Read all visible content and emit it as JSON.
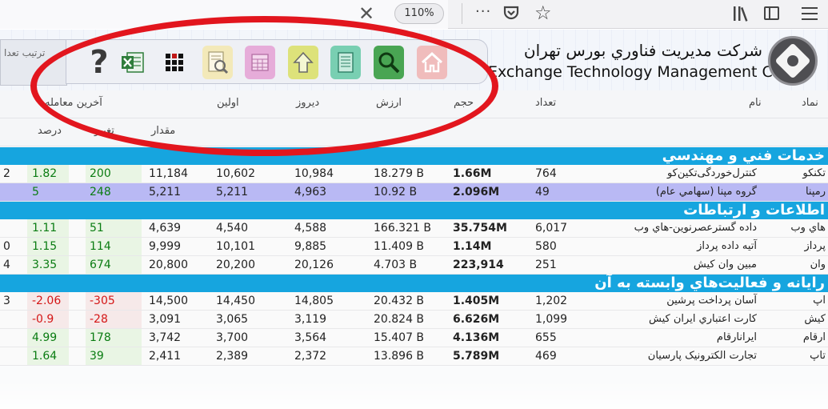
{
  "browser": {
    "close_glyph": "✕",
    "zoom": "110%",
    "more_glyph": "···",
    "star_glyph": "☆"
  },
  "header": {
    "left_field_text": "ترتیب تعدا",
    "left_field_text2": "ر",
    "company_fa": "شركت مديريت فناوري بورس تهران",
    "company_en": "Exchange Technology Management Co",
    "help_glyph": "?"
  },
  "table": {
    "header_top": {
      "last_trade": "آخرین معامله",
      "first": "اولین",
      "yesterday": "دیروز",
      "value": "ارزش",
      "volume": "حجم",
      "count": "تعداد",
      "name": "نام",
      "symbol": "نماد"
    },
    "header_sub": {
      "percent": "درصد",
      "change": "تغییر",
      "amount": "مقدار"
    },
    "sections": [
      {
        "title": "خدمات فني و مهندسي",
        "rows": [
          {
            "edge": "2",
            "pct": "1.82",
            "chg": "200",
            "last": "11,184",
            "first": "10,602",
            "yest": "10,984",
            "val": "18.279 B",
            "vol": "1.66M",
            "cnt": "764",
            "name": "کنترل‌خوردگی‌تکین‌کو",
            "sym": "تکنکو",
            "dir": "pos",
            "hl": false
          },
          {
            "edge": "",
            "pct": "5",
            "chg": "248",
            "last": "5,211",
            "first": "5,211",
            "yest": "4,963",
            "val": "10.92 B",
            "vol": "2.096M",
            "cnt": "49",
            "name": "گروه مپنا (سهامي عام)",
            "sym": "رمپنا",
            "dir": "pos",
            "hl": true
          }
        ]
      },
      {
        "title": "اطلاعات و ارتباطات",
        "rows": [
          {
            "edge": "",
            "pct": "1.11",
            "chg": "51",
            "last": "4,639",
            "first": "4,540",
            "yest": "4,588",
            "val": "166.321 B",
            "vol": "35.754M",
            "cnt": "6,017",
            "name": "داده گسترعصرنوين-هاي وب",
            "sym": "هاي وب",
            "dir": "pos",
            "hl": false
          },
          {
            "edge": "0",
            "pct": "1.15",
            "chg": "114",
            "last": "9,999",
            "first": "10,101",
            "yest": "9,885",
            "val": "11.409 B",
            "vol": "1.14M",
            "cnt": "580",
            "name": "آتیه داده پرداز",
            "sym": "پرداز",
            "dir": "pos",
            "hl": false
          },
          {
            "edge": "4",
            "pct": "3.35",
            "chg": "674",
            "last": "20,800",
            "first": "20,200",
            "yest": "20,126",
            "val": "4.703 B",
            "vol": "223,914",
            "cnt": "251",
            "name": "مبین وان کیش",
            "sym": "وان",
            "dir": "pos",
            "hl": false
          }
        ]
      },
      {
        "title": "رايانه و فعاليت‌هاي وابسته به آن",
        "rows": [
          {
            "edge": "3",
            "pct": "-2.06",
            "chg": "-305",
            "last": "14,500",
            "first": "14,450",
            "yest": "14,805",
            "val": "20.432 B",
            "vol": "1.405M",
            "cnt": "1,202",
            "name": "آسان پرداخت پرشین",
            "sym": "آپ",
            "dir": "neg",
            "hl": false
          },
          {
            "edge": "",
            "pct": "-0.9",
            "chg": "-28",
            "last": "3,091",
            "first": "3,065",
            "yest": "3,119",
            "val": "20.824 B",
            "vol": "6.626M",
            "cnt": "1,099",
            "name": "كارت اعتباري ايران كيش",
            "sym": "كيش",
            "dir": "neg",
            "hl": false
          },
          {
            "edge": "",
            "pct": "4.99",
            "chg": "178",
            "last": "3,742",
            "first": "3,700",
            "yest": "3,564",
            "val": "15.407 B",
            "vol": "4.136M",
            "cnt": "655",
            "name": "ايرانارقام",
            "sym": "ارقام",
            "dir": "pos",
            "hl": false
          },
          {
            "edge": "",
            "pct": "1.64",
            "chg": "39",
            "last": "2,411",
            "first": "2,389",
            "yest": "2,372",
            "val": "13.896 B",
            "vol": "5.789M",
            "cnt": "469",
            "name": "تجارت الکترونیک پارسیان",
            "sym": "تاپ",
            "dir": "pos",
            "hl": false
          }
        ]
      }
    ]
  },
  "colors": {
    "section_bg": "#16a5df",
    "highlight_row": "#b9b9f4",
    "positive": "#0a7c12",
    "negative": "#d41616",
    "annotation": "#e2161e"
  },
  "icons": [
    "close-icon",
    "more-icon",
    "pocket-icon",
    "star-icon",
    "library-icon",
    "sidebar-icon",
    "menu-icon",
    "help-icon",
    "excel-icon",
    "grid-icon",
    "preview-icon",
    "calendar-icon",
    "upload-icon",
    "list-icon",
    "search-icon",
    "home-icon"
  ]
}
